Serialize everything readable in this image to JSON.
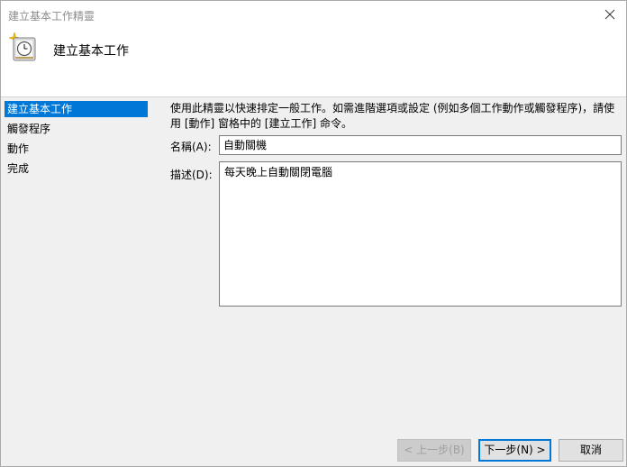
{
  "window": {
    "title": "建立基本工作精靈"
  },
  "header": {
    "title": "建立基本工作",
    "icon": "task-scheduler-clock-icon"
  },
  "sidebar": {
    "items": [
      {
        "label": "建立基本工作",
        "active": true
      },
      {
        "label": "觸發程序",
        "active": false
      },
      {
        "label": "動作",
        "active": false
      },
      {
        "label": "完成",
        "active": false
      }
    ]
  },
  "main": {
    "description": "使用此精靈以快速排定一般工作。如需進階選項或設定 (例如多個工作動作或觸發程序)，請使用 [動作] 窗格中的 [建立工作] 命令。",
    "name_label": "名稱(A):",
    "name_value": "自動關機",
    "description_label": "描述(D):",
    "description_value": "每天晚上自動關閉電腦"
  },
  "buttons": {
    "back": "< 上一步(B)",
    "next": "下一步(N) >",
    "cancel": "取消"
  },
  "colors": {
    "accent": "#0078d7"
  }
}
